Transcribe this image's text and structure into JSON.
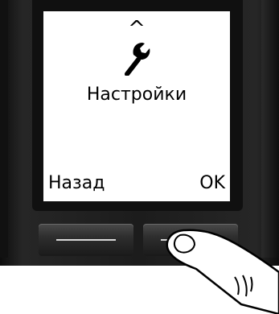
{
  "screen": {
    "nav_indicator": "^",
    "icon": "wrench-icon",
    "menu_title": "Настройки",
    "softkey_left": "Назад",
    "softkey_right": "OK"
  },
  "colors": {
    "screen_background": "#ffffff",
    "screen_text": "#000000",
    "device_body": "#1c1c1c"
  }
}
